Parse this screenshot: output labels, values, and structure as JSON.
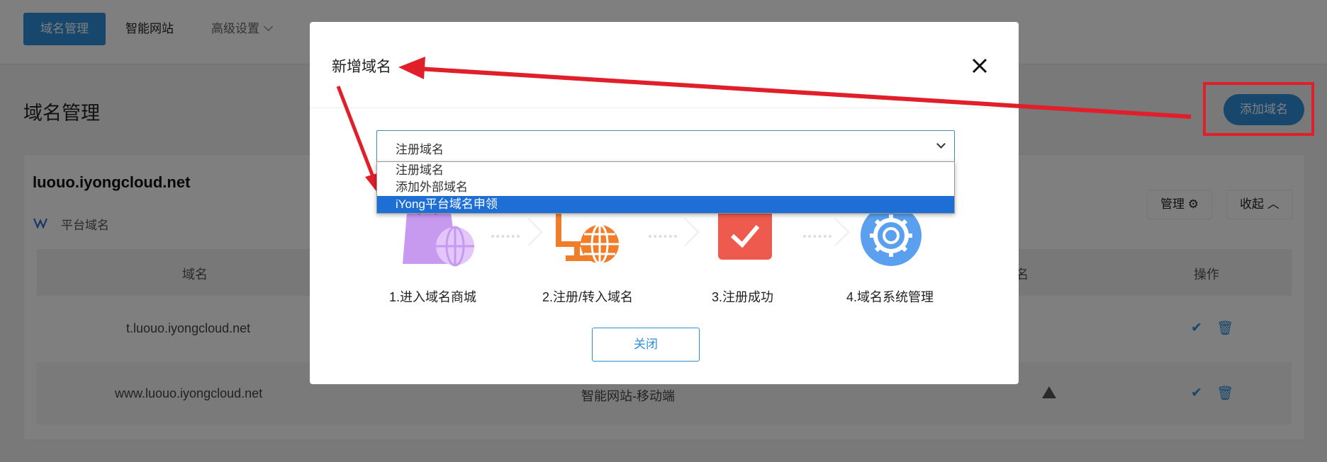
{
  "nav": {
    "active_tab": "域名管理",
    "site_tab": "智能网站",
    "advanced_tab": "高级设置"
  },
  "page": {
    "title": "域名管理",
    "add_button": "添加域名"
  },
  "card": {
    "domain_title": "luouo.iyongcloud.net",
    "platform_label": "平台域名",
    "manage_button": "管理",
    "collapse_button": "收起"
  },
  "table": {
    "headers": [
      "域名",
      "名",
      "操作"
    ],
    "rows": [
      {
        "domain": "t.luouo.iyongcloud.net",
        "site": ""
      },
      {
        "domain": "www.luouo.iyongcloud.net",
        "site": "智能网站-移动端"
      }
    ]
  },
  "modal": {
    "title": "新增域名",
    "select_value": "注册域名",
    "options": [
      "注册域名",
      "添加外部域名",
      "iYong平台域名申领"
    ],
    "steps": [
      "1.进入域名商城",
      "2.注册/转入域名",
      "3.注册成功",
      "4.域名系统管理"
    ],
    "close_button": "关闭"
  },
  "colors": {
    "primary": "#2f8fd8",
    "annotation_red": "#e01f2b",
    "selected_option": "#1d6fd6"
  }
}
